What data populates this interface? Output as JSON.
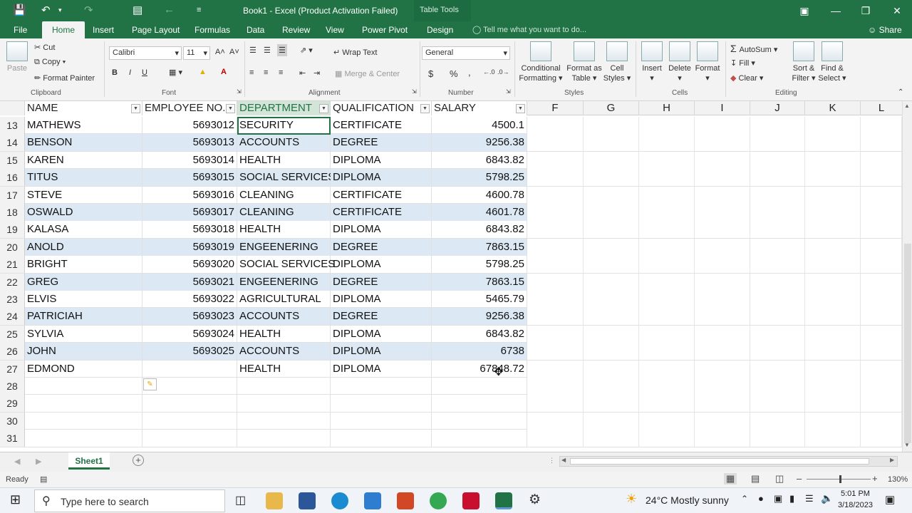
{
  "titlebar": {
    "title": "Book1 - Excel (Product Activation Failed)",
    "context": "Table Tools"
  },
  "tabs": [
    "File",
    "Home",
    "Insert",
    "Page Layout",
    "Formulas",
    "Data",
    "Review",
    "View",
    "Power Pivot",
    "Design"
  ],
  "tellme": "Tell me what you want to do...",
  "share": "Share",
  "ribbon": {
    "clipboard": {
      "paste": "Paste",
      "cut": "Cut",
      "copy": "Copy",
      "painter": "Format Painter",
      "label": "Clipboard"
    },
    "font": {
      "name": "Calibri",
      "size": "11",
      "bold": "B",
      "italic": "I",
      "underline": "U",
      "label": "Font"
    },
    "alignment": {
      "wrap": "Wrap Text",
      "merge": "Merge & Center",
      "label": "Alignment"
    },
    "number": {
      "format": "General",
      "currency": "$",
      "percent": "%",
      "comma": ",",
      "label": "Number"
    },
    "styles": {
      "conditional": "Conditional",
      "conditional2": "Formatting",
      "table": "Format as",
      "table2": "Table",
      "cell": "Cell",
      "cell2": "Styles",
      "label": "Styles"
    },
    "cells": {
      "insert": "Insert",
      "delete": "Delete",
      "format": "Format",
      "label": "Cells"
    },
    "editing": {
      "autosum": "AutoSum",
      "fill": "Fill",
      "clear": "Clear",
      "sort": "Sort &",
      "sort2": "Filter",
      "find": "Find &",
      "find2": "Select",
      "label": "Editing"
    }
  },
  "columns": [
    "NAME",
    "EMPLOYEE NO.",
    "DEPARTMENT",
    "QUALIFICATION",
    "SALARY",
    "F",
    "G",
    "H",
    "I",
    "J",
    "K",
    "L"
  ],
  "rows": [
    {
      "n": "13",
      "name": "MATHEWS",
      "emp": "5693012",
      "dept": "SECURITY",
      "qual": "CERTIFICATE",
      "sal": "4500.1"
    },
    {
      "n": "14",
      "name": "BENSON",
      "emp": "5693013",
      "dept": "ACCOUNTS",
      "qual": "DEGREE",
      "sal": "9256.38"
    },
    {
      "n": "15",
      "name": "KAREN",
      "emp": "5693014",
      "dept": "HEALTH",
      "qual": "DIPLOMA",
      "sal": "6843.82"
    },
    {
      "n": "16",
      "name": "TITUS",
      "emp": "5693015",
      "dept": "SOCIAL SERVICES",
      "qual": "DIPLOMA",
      "sal": "5798.25"
    },
    {
      "n": "17",
      "name": "STEVE",
      "emp": "5693016",
      "dept": "CLEANING",
      "qual": "CERTIFICATE",
      "sal": "4600.78"
    },
    {
      "n": "18",
      "name": "OSWALD",
      "emp": "5693017",
      "dept": "CLEANING",
      "qual": "CERTIFICATE",
      "sal": "4601.78"
    },
    {
      "n": "19",
      "name": "KALASA",
      "emp": "5693018",
      "dept": "HEALTH",
      "qual": "DIPLOMA",
      "sal": "6843.82"
    },
    {
      "n": "20",
      "name": "ANOLD",
      "emp": "5693019",
      "dept": "ENGEENERING",
      "qual": "DEGREE",
      "sal": "7863.15"
    },
    {
      "n": "21",
      "name": "BRIGHT",
      "emp": "5693020",
      "dept": "SOCIAL SERVICES",
      "qual": "DIPLOMA",
      "sal": "5798.25"
    },
    {
      "n": "22",
      "name": "GREG",
      "emp": "5693021",
      "dept": "ENGEENERING",
      "qual": "DEGREE",
      "sal": "7863.15"
    },
    {
      "n": "23",
      "name": "ELVIS",
      "emp": "5693022",
      "dept": "AGRICULTURAL",
      "qual": "DIPLOMA",
      "sal": "5465.79"
    },
    {
      "n": "24",
      "name": "PATRICIAH",
      "emp": "5693023",
      "dept": "ACCOUNTS",
      "qual": "DEGREE",
      "sal": "9256.38"
    },
    {
      "n": "25",
      "name": "SYLVIA",
      "emp": "5693024",
      "dept": "HEALTH",
      "qual": "DIPLOMA",
      "sal": "6843.82"
    },
    {
      "n": "26",
      "name": "JOHN",
      "emp": "5693025",
      "dept": "ACCOUNTS",
      "qual": "DIPLOMA",
      "sal": "6738"
    },
    {
      "n": "27",
      "name": "EDMOND",
      "emp": "",
      "dept": "HEALTH",
      "qual": "DIPLOMA",
      "sal": "67848.72"
    },
    {
      "n": "28",
      "name": "",
      "emp": "",
      "dept": "",
      "qual": "",
      "sal": ""
    },
    {
      "n": "29",
      "name": "",
      "emp": "",
      "dept": "",
      "qual": "",
      "sal": ""
    },
    {
      "n": "30",
      "name": "",
      "emp": "",
      "dept": "",
      "qual": "",
      "sal": ""
    },
    {
      "n": "31",
      "name": "",
      "emp": "",
      "dept": "",
      "qual": "",
      "sal": ""
    }
  ],
  "sheet": {
    "tab": "Sheet1"
  },
  "status": {
    "ready": "Ready",
    "zoom": "130%"
  },
  "taskbar": {
    "search": "Type here to search",
    "weather": "24°C  Mostly sunny",
    "time": "5:01 PM",
    "date": "3/18/2023"
  },
  "colors": {
    "excel_green": "#217346",
    "band": "#dce9f5"
  }
}
